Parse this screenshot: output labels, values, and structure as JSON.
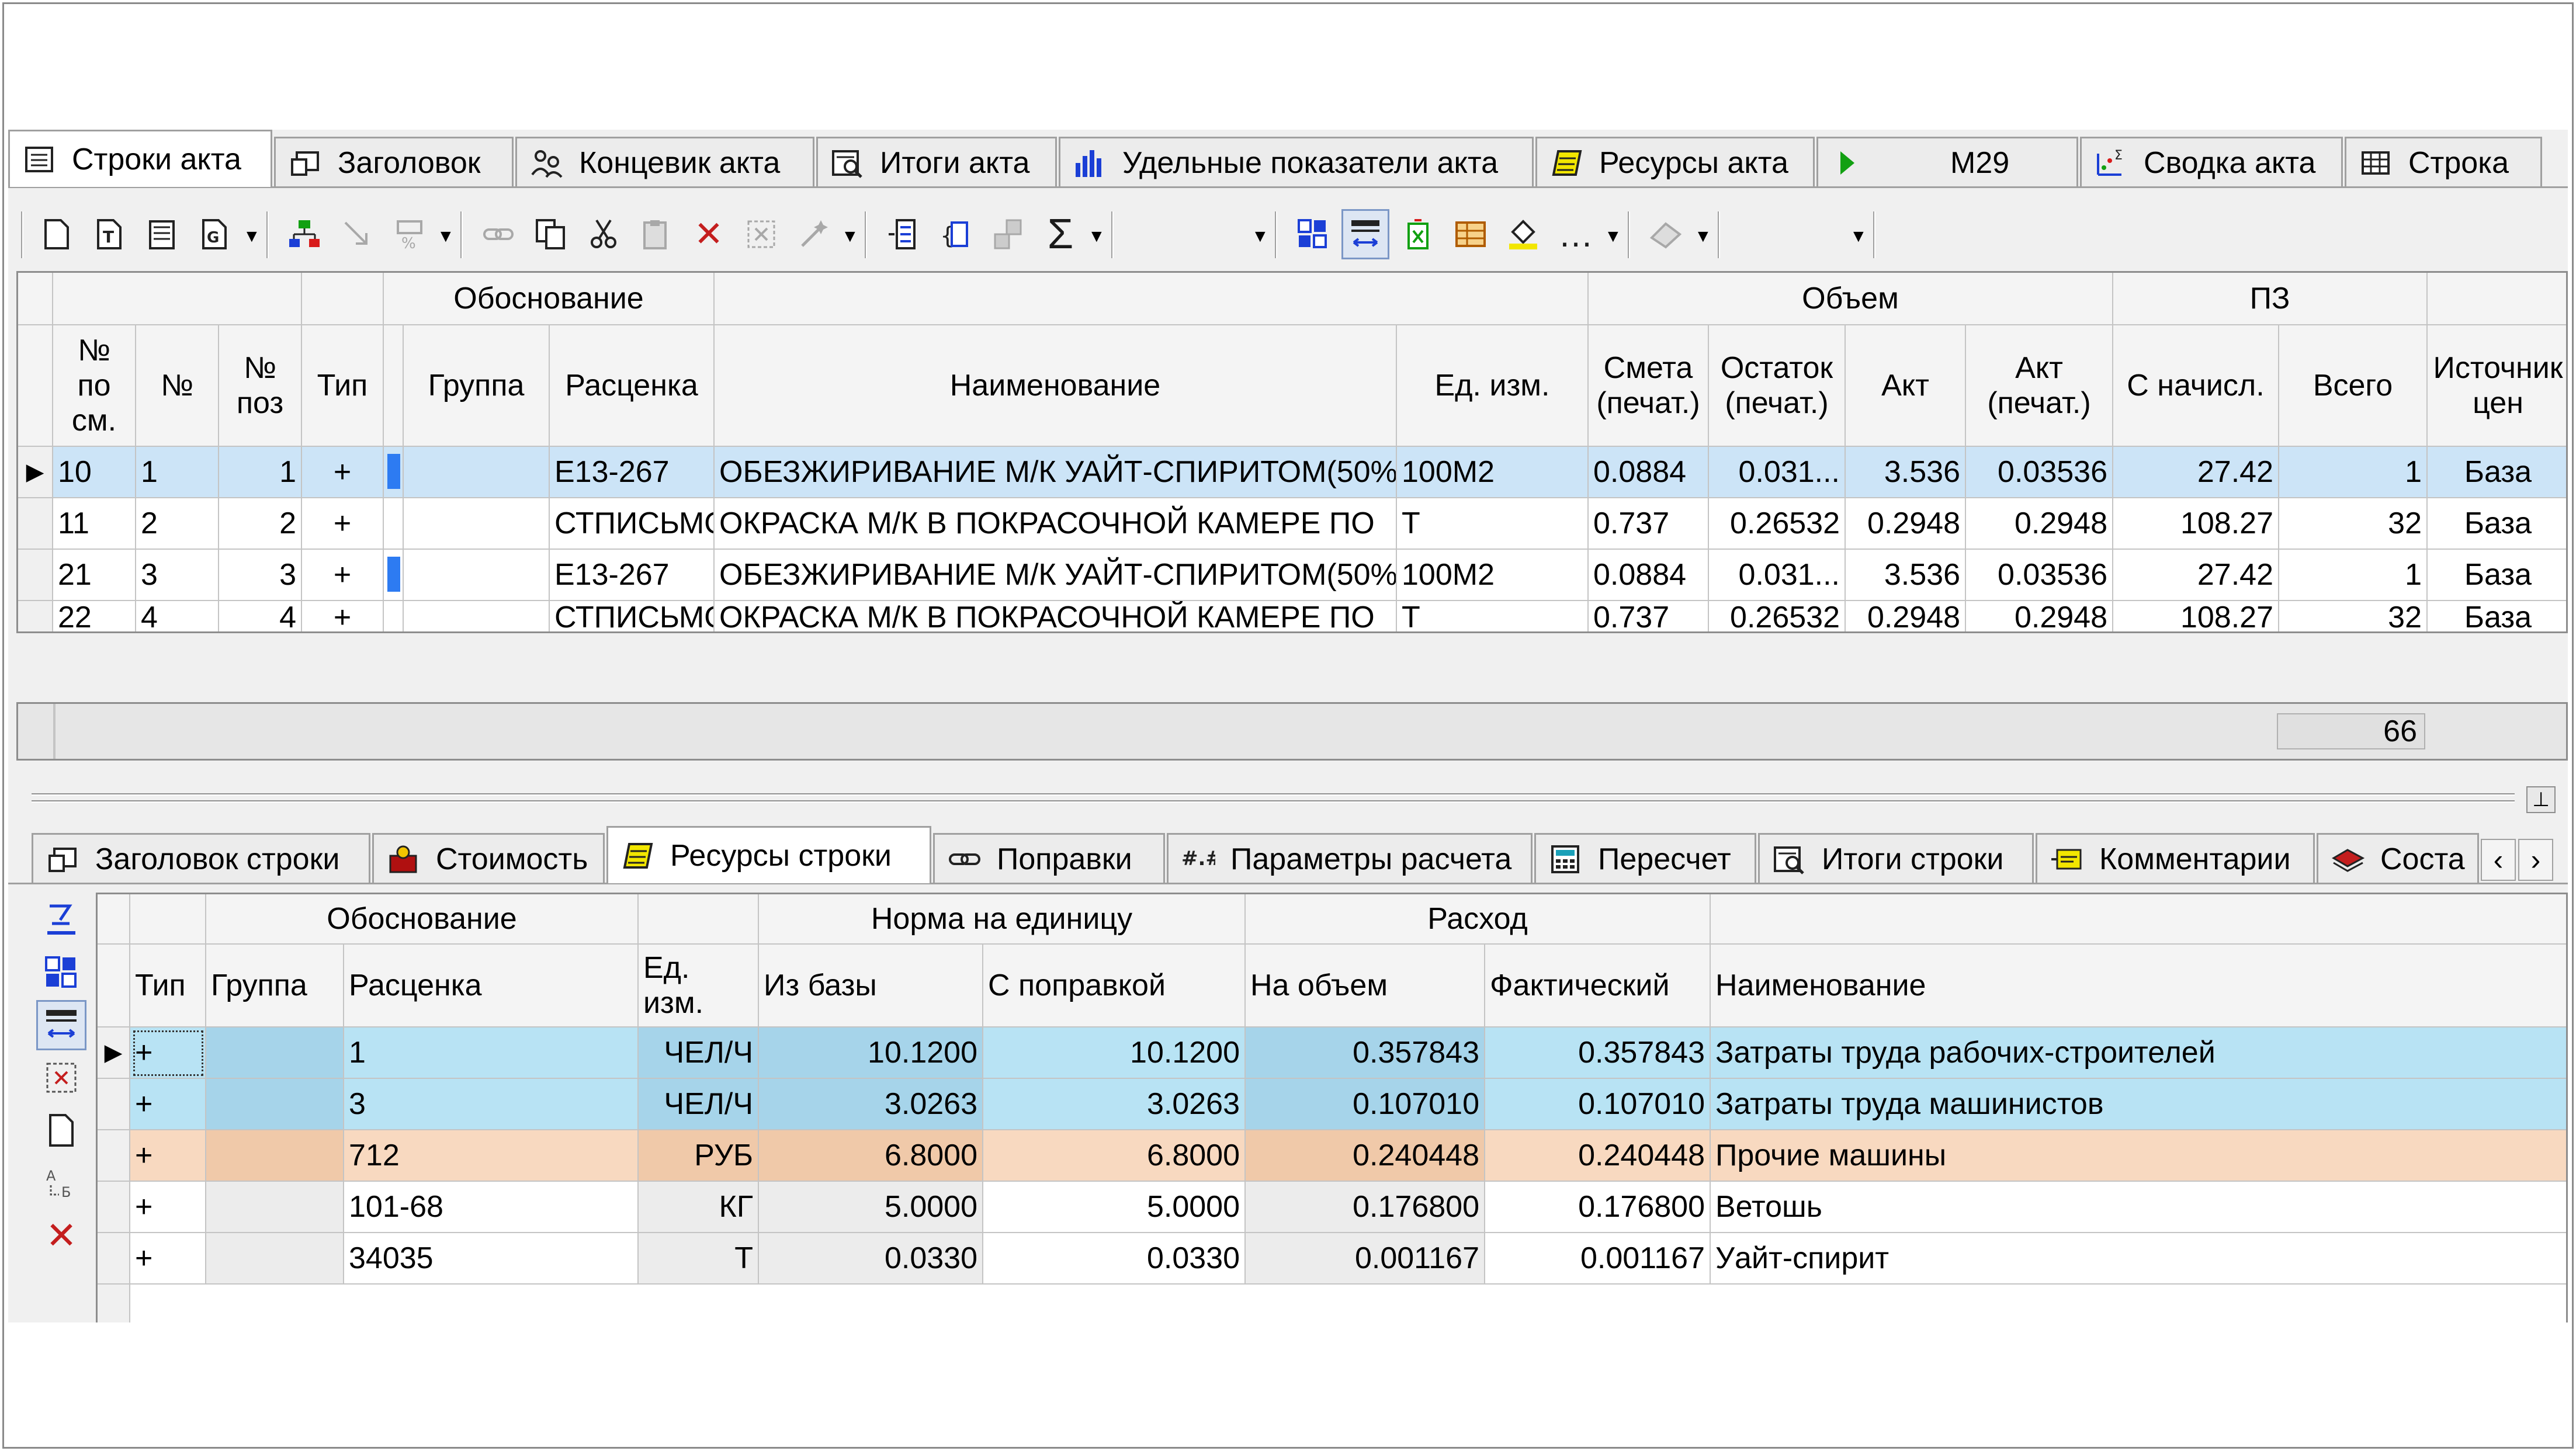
{
  "top_tabs": [
    {
      "label": "Строки акта",
      "icon": "table-icon",
      "active": true
    },
    {
      "label": "Заголовок",
      "icon": "header-icon",
      "active": false
    },
    {
      "label": "Концевик акта",
      "icon": "people-icon",
      "active": false
    },
    {
      "label": "Итоги акта",
      "icon": "totals-icon",
      "active": false
    },
    {
      "label": "Удельные показатели акта",
      "icon": "bar-chart-icon",
      "active": false
    },
    {
      "label": "Ресурсы акта",
      "icon": "resources-icon",
      "active": false
    },
    {
      "label": "М29",
      "icon": "play-icon",
      "active": false
    },
    {
      "label": "Сводка акта",
      "icon": "summary-icon",
      "active": false
    },
    {
      "label": "Строка",
      "icon": "grid-icon",
      "active": false
    }
  ],
  "upper_grid": {
    "group_headers": {
      "obosnovanie": "Обоснование",
      "obem": "Объем",
      "pz": "ПЗ"
    },
    "columns": {
      "pos_sm": "№ по см.",
      "num": "№",
      "pos": "№ поз",
      "type": "Тип",
      "group": "Группа",
      "rate": "Расценка",
      "name": "Наименование",
      "unit": "Ед. изм.",
      "smeta": "Смета (печат.)",
      "ostatok": "Остаток (печат.)",
      "akt": "Акт",
      "akt_print": "Акт (печат.)",
      "s_nachisl": "С начисл.",
      "vsego": "Всего",
      "source": "Источник цен"
    },
    "rows": [
      {
        "pos_sm": "10",
        "num": "1",
        "pos": "1",
        "type": "+",
        "group": "",
        "rate": "Е13-267",
        "name": "ОБЕЗЖИРИВАНИЕ М/К УАЙТ-СПИРИТОМ(50%",
        "unit": "100М2",
        "smeta": "0.0884",
        "ostatok": "0.031...",
        "akt": "3.536",
        "akt_print": "0.03536",
        "s_nachisl": "27.42",
        "vsego": "1",
        "source": "База"
      },
      {
        "pos_sm": "11",
        "num": "2",
        "pos": "2",
        "type": "+",
        "group": "",
        "rate": "СТПИСЬМО",
        "name": "ОКРАСКА М/К В ПОКРАСОЧНОЙ КАМЕРЕ ПО",
        "unit": "Т",
        "smeta": "0.737",
        "ostatok": "0.26532",
        "akt": "0.2948",
        "akt_print": "0.2948",
        "s_nachisl": "108.27",
        "vsego": "32",
        "source": "База"
      },
      {
        "pos_sm": "21",
        "num": "3",
        "pos": "3",
        "type": "+",
        "group": "",
        "rate": "Е13-267",
        "name": "ОБЕЗЖИРИВАНИЕ М/К УАЙТ-СПИРИТОМ(50%",
        "unit": "100М2",
        "smeta": "0.0884",
        "ostatok": "0.031...",
        "akt": "3.536",
        "akt_print": "0.03536",
        "s_nachisl": "27.42",
        "vsego": "1",
        "source": "База"
      },
      {
        "pos_sm": "22",
        "num": "4",
        "pos": "4",
        "type": "+",
        "group": "",
        "rate": "СТПИСЬМО",
        "name": "ОКРАСКА М/К В ПОКРАСОЧНОЙ КАМЕРЕ ПО",
        "unit": "Т",
        "smeta": "0.737",
        "ostatok": "0.26532",
        "akt": "0.2948",
        "akt_print": "0.2948",
        "s_nachisl": "108.27",
        "vsego": "32",
        "source": "База"
      }
    ],
    "footer_total": "66"
  },
  "bottom_tabs": [
    {
      "label": "Заголовок строки",
      "icon": "header-icon",
      "active": false
    },
    {
      "label": "Стоимость",
      "icon": "cost-icon",
      "active": false
    },
    {
      "label": "Ресурсы строки",
      "icon": "resources-icon",
      "active": true
    },
    {
      "label": "Поправки",
      "icon": "link-icon",
      "active": false
    },
    {
      "label": "Параметры расчета",
      "icon": "params-icon",
      "active": false
    },
    {
      "label": "Пересчет",
      "icon": "calculator-icon",
      "active": false
    },
    {
      "label": "Итоги строки",
      "icon": "totals-icon",
      "active": false
    },
    {
      "label": "Комментарии",
      "icon": "comment-icon",
      "active": false
    },
    {
      "label": "Соста",
      "icon": "composition-icon",
      "active": false
    }
  ],
  "lower_grid": {
    "group_headers": {
      "obosnovanie": "Обоснование",
      "norma": "Норма на единицу",
      "rashod": "Расход"
    },
    "columns": {
      "type": "Тип",
      "group": "Группа",
      "rate": "Расценка",
      "unit": "Ед. изм.",
      "from_base": "Из базы",
      "with_corr": "С поправкой",
      "per_volume": "На объем",
      "actual": "Фактический",
      "name": "Наименование"
    },
    "rows": [
      {
        "type": "+",
        "group": "",
        "rate": "1",
        "unit": "ЧЕЛ/Ч",
        "from_base": "10.1200",
        "with_corr": "10.1200",
        "per_volume": "0.357843",
        "actual": "0.357843",
        "name": "Затраты труда рабочих-строителей",
        "tone": "blue"
      },
      {
        "type": "+",
        "group": "",
        "rate": "3",
        "unit": "ЧЕЛ/Ч",
        "from_base": "3.0263",
        "with_corr": "3.0263",
        "per_volume": "0.107010",
        "actual": "0.107010",
        "name": "Затраты труда машинистов",
        "tone": "blue"
      },
      {
        "type": "+",
        "group": "",
        "rate": "712",
        "unit": "РУБ",
        "from_base": "6.8000",
        "with_corr": "6.8000",
        "per_volume": "0.240448",
        "actual": "0.240448",
        "name": "Прочие машины",
        "tone": "orange"
      },
      {
        "type": "+",
        "group": "",
        "rate": "101-68",
        "unit": "КГ",
        "from_base": "5.0000",
        "with_corr": "5.0000",
        "per_volume": "0.176800",
        "actual": "0.176800",
        "name": "Ветошь",
        "tone": "white"
      },
      {
        "type": "+",
        "group": "",
        "rate": "34035",
        "unit": "Т",
        "from_base": "0.0330",
        "with_corr": "0.0330",
        "per_volume": "0.001167",
        "actual": "0.001167",
        "name": "Уайт-спирит",
        "tone": "white"
      }
    ]
  },
  "colors": {
    "selected_row": "#cce4f7",
    "resource_blue": "#b8e3f4",
    "resource_orange": "#f8d9c0",
    "marker_blue": "#2d7bf2",
    "delete_red": "#c41e1e"
  }
}
